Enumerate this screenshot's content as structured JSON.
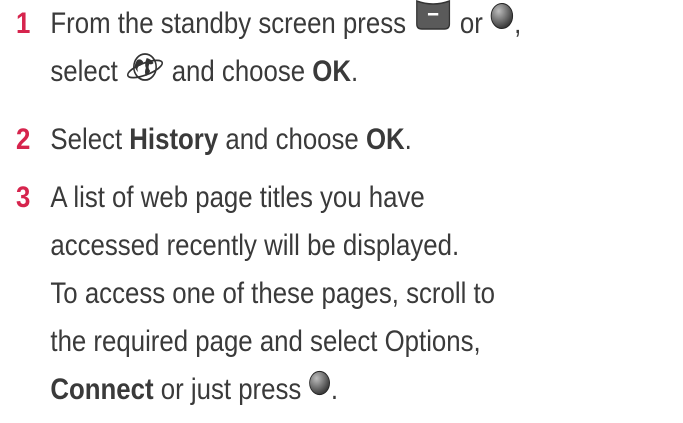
{
  "steps": [
    {
      "number": "1",
      "line1_text": "From the standby screen press",
      "line1_or": "or",
      "line1_comma": ",",
      "line2_select": "select",
      "line2_and_choose": "and choose",
      "line2_ok": "OK",
      "line2_period": "."
    },
    {
      "number": "2",
      "select": "Select",
      "history": "History",
      "and_choose": "and choose",
      "ok": "OK",
      "period": "."
    },
    {
      "number": "3",
      "line1": "A list of web page titles you have",
      "line2": "accessed recently will be displayed.",
      "line3": "To access one of these pages, scroll to",
      "line4": "the required page and select Options,",
      "connect": "Connect",
      "or_just_press": "or just press",
      "period": "."
    }
  ],
  "icons": {
    "softkey": "left-soft-key-icon",
    "ok_key": "ok-key-icon",
    "browser": "globe-browser-icon"
  },
  "colors": {
    "step_number": "#d6244d",
    "text": "#3a3a3a"
  }
}
